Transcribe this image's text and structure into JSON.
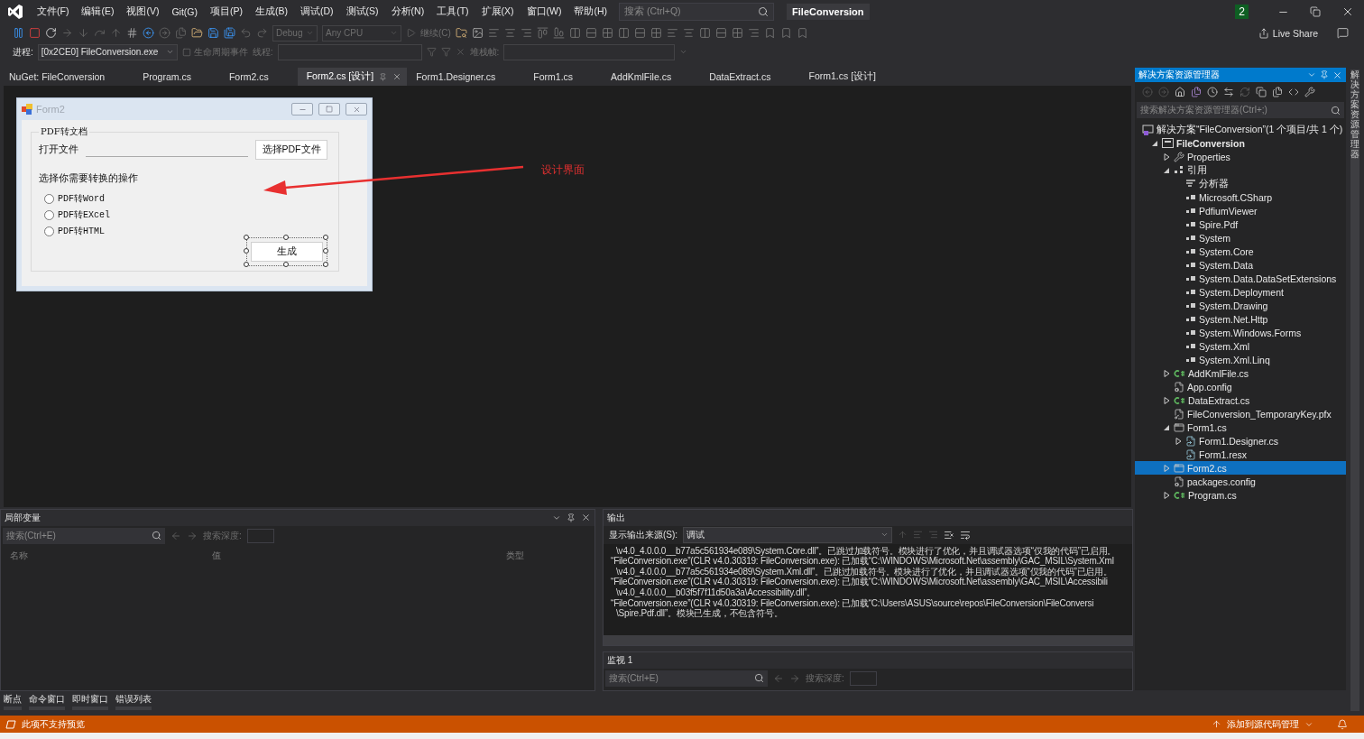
{
  "title_bar": {
    "menu": [
      "文件(F)",
      "编辑(E)",
      "视图(V)",
      "Git(G)",
      "项目(P)",
      "生成(B)",
      "调试(D)",
      "测试(S)",
      "分析(N)",
      "工具(T)",
      "扩展(X)",
      "窗口(W)",
      "帮助(H)"
    ],
    "search": {
      "placeholder": "搜索 (Ctrl+Q)"
    },
    "title": "FileConversion",
    "badge": "2"
  },
  "toolbar": {
    "configuration": {
      "value": "Debug",
      "disabled": true
    },
    "platform": {
      "value": "Any CPU",
      "disabled": true
    },
    "continue": {
      "label": "继续(C)",
      "disabled": true
    },
    "live_share": "Live Share"
  },
  "debug_location": {
    "process_label": "进程:",
    "process": "[0x2CE0] FileConversion.exe",
    "lifecycle": {
      "label": "生命周期事件",
      "disabled": true
    },
    "thread_label": "线程:",
    "stack_label": "堆栈帧:"
  },
  "tabs": [
    {
      "label": "NuGet: FileConversion",
      "selected": false
    },
    {
      "label": "Program.cs",
      "selected": false
    },
    {
      "label": "Form2.cs",
      "selected": false
    },
    {
      "label": "Form2.cs [设计]",
      "selected": true
    },
    {
      "label": "Form1.Designer.cs",
      "selected": false
    },
    {
      "label": "Form1.cs",
      "selected": false
    },
    {
      "label": "AddKmlFile.cs",
      "selected": false
    },
    {
      "label": "DataExtract.cs",
      "selected": false
    },
    {
      "label": "Form1.cs [设计]",
      "selected": false
    }
  ],
  "designer": {
    "form": {
      "title": "Form2",
      "group_title": "PDF转文档",
      "open_label": "打开文件",
      "browse_button": "选择PDF文件",
      "operation_label": "选择你需要转换的操作",
      "options": [
        {
          "label": "PDF转Word",
          "checked": false
        },
        {
          "label": "PDF转EXcel",
          "checked": false
        },
        {
          "label": "PDF转HTML",
          "checked": false
        }
      ],
      "generate_button": {
        "label": "生成",
        "selected": true
      }
    },
    "annotation": "设计界面"
  },
  "solution_explorer": {
    "title": "解决方案资源管理器",
    "search": {
      "placeholder": "搜索解决方案资源管理器(Ctrl+;)"
    },
    "tree": [
      {
        "label": "解决方案“FileConversion”(1 个项目/共 1 个)",
        "kind": "solution",
        "selected": false,
        "children": [
          {
            "label": "FileConversion",
            "kind": "project",
            "expanded": true,
            "selected": false,
            "children": [
              {
                "label": "Properties",
                "kind": "properties",
                "expanded": false,
                "selected": false
              },
              {
                "label": "引用",
                "kind": "references",
                "expanded": true,
                "selected": false,
                "children": [
                  {
                    "label": "分析器",
                    "kind": "analyzer",
                    "selected": false
                  },
                  {
                    "label": "Microsoft.CSharp",
                    "kind": "assembly",
                    "selected": false
                  },
                  {
                    "label": "PdfiumViewer",
                    "kind": "assembly",
                    "selected": false
                  },
                  {
                    "label": "Spire.Pdf",
                    "kind": "assembly",
                    "selected": false
                  },
                  {
                    "label": "System",
                    "kind": "assembly",
                    "selected": false
                  },
                  {
                    "label": "System.Core",
                    "kind": "assembly",
                    "selected": false
                  },
                  {
                    "label": "System.Data",
                    "kind": "assembly",
                    "selected": false
                  },
                  {
                    "label": "System.Data.DataSetExtensions",
                    "kind": "assembly",
                    "selected": false
                  },
                  {
                    "label": "System.Deployment",
                    "kind": "assembly",
                    "selected": false
                  },
                  {
                    "label": "System.Drawing",
                    "kind": "assembly",
                    "selected": false
                  },
                  {
                    "label": "System.Net.Http",
                    "kind": "assembly",
                    "selected": false
                  },
                  {
                    "label": "System.Windows.Forms",
                    "kind": "assembly",
                    "selected": false
                  },
                  {
                    "label": "System.Xml",
                    "kind": "assembly",
                    "selected": false
                  },
                  {
                    "label": "System.Xml.Linq",
                    "kind": "assembly",
                    "selected": false
                  }
                ]
              },
              {
                "label": "AddKmlFile.cs",
                "kind": "csharp",
                "expanded": false,
                "selected": false
              },
              {
                "label": "App.config",
                "kind": "config",
                "selected": false
              },
              {
                "label": "DataExtract.cs",
                "kind": "csharp",
                "expanded": false,
                "selected": false
              },
              {
                "label": "FileConversion_TemporaryKey.pfx",
                "kind": "key",
                "selected": false
              },
              {
                "label": "Form1.cs",
                "kind": "form",
                "expanded": true,
                "selected": false,
                "children": [
                  {
                    "label": "Form1.Designer.cs",
                    "kind": "designer",
                    "expanded": false,
                    "selected": false
                  },
                  {
                    "label": "Form1.resx",
                    "kind": "designer",
                    "selected": false
                  }
                ]
              },
              {
                "label": "Form2.cs",
                "kind": "form",
                "expanded": false,
                "selected": true
              },
              {
                "label": "packages.config",
                "kind": "config",
                "selected": false
              },
              {
                "label": "Program.cs",
                "kind": "csharp",
                "expanded": false,
                "selected": false
              }
            ]
          }
        ]
      }
    ]
  },
  "side_tab": "解决方案资源管理器",
  "locals": {
    "title": "局部变量",
    "search": {
      "placeholder": "搜索(Ctrl+E)"
    },
    "depth_label": "搜索深度:",
    "columns": [
      "名称",
      "值",
      "类型"
    ]
  },
  "bottom_tabs": [
    "断点",
    "命令窗口",
    "即时窗口",
    "错误列表"
  ],
  "output": {
    "title": "输出",
    "source_label": "显示输出来源(S):",
    "source": "调试",
    "lines": [
      {
        "kind": "continuation",
        "text": "\\v4.0_4.0.0.0__b77a5c561934e089\\System.Core.dll”。已跳过加载符号。模块进行了优化，并且调试器选项“仅我的代码”已启用。"
      },
      {
        "kind": "entry",
        "text": "“FileConversion.exe”(CLR v4.0.30319: FileConversion.exe): 已加载“C:\\WINDOWS\\Microsoft.Net\\assembly\\GAC_MSIL\\System.Xml"
      },
      {
        "kind": "continuation",
        "text": "\\v4.0_4.0.0.0__b77a5c561934e089\\System.Xml.dll”。已跳过加载符号。模块进行了优化，并且调试器选项“仅我的代码”已启用。"
      },
      {
        "kind": "entry",
        "text": "“FileConversion.exe”(CLR v4.0.30319: FileConversion.exe): 已加载“C:\\WINDOWS\\Microsoft.Net\\assembly\\GAC_MSIL\\Accessibili"
      },
      {
        "kind": "continuation",
        "text": "\\v4.0_4.0.0.0__b03f5f7f11d50a3a\\Accessibility.dll”。"
      },
      {
        "kind": "entry",
        "text": "“FileConversion.exe”(CLR v4.0.30319: FileConversion.exe): 已加载“C:\\Users\\ASUS\\source\\repos\\FileConversion\\FileConversi"
      },
      {
        "kind": "continuation",
        "text": "\\Spire.Pdf.dll”。模块已生成，不包含符号。"
      }
    ]
  },
  "watch": {
    "title": "监视 1",
    "search": {
      "placeholder": "搜索(Ctrl+E)"
    },
    "depth_label": "搜索深度:"
  },
  "status_bar": {
    "message": "此项不支持预览",
    "source_control": "添加到源代码管理"
  }
}
